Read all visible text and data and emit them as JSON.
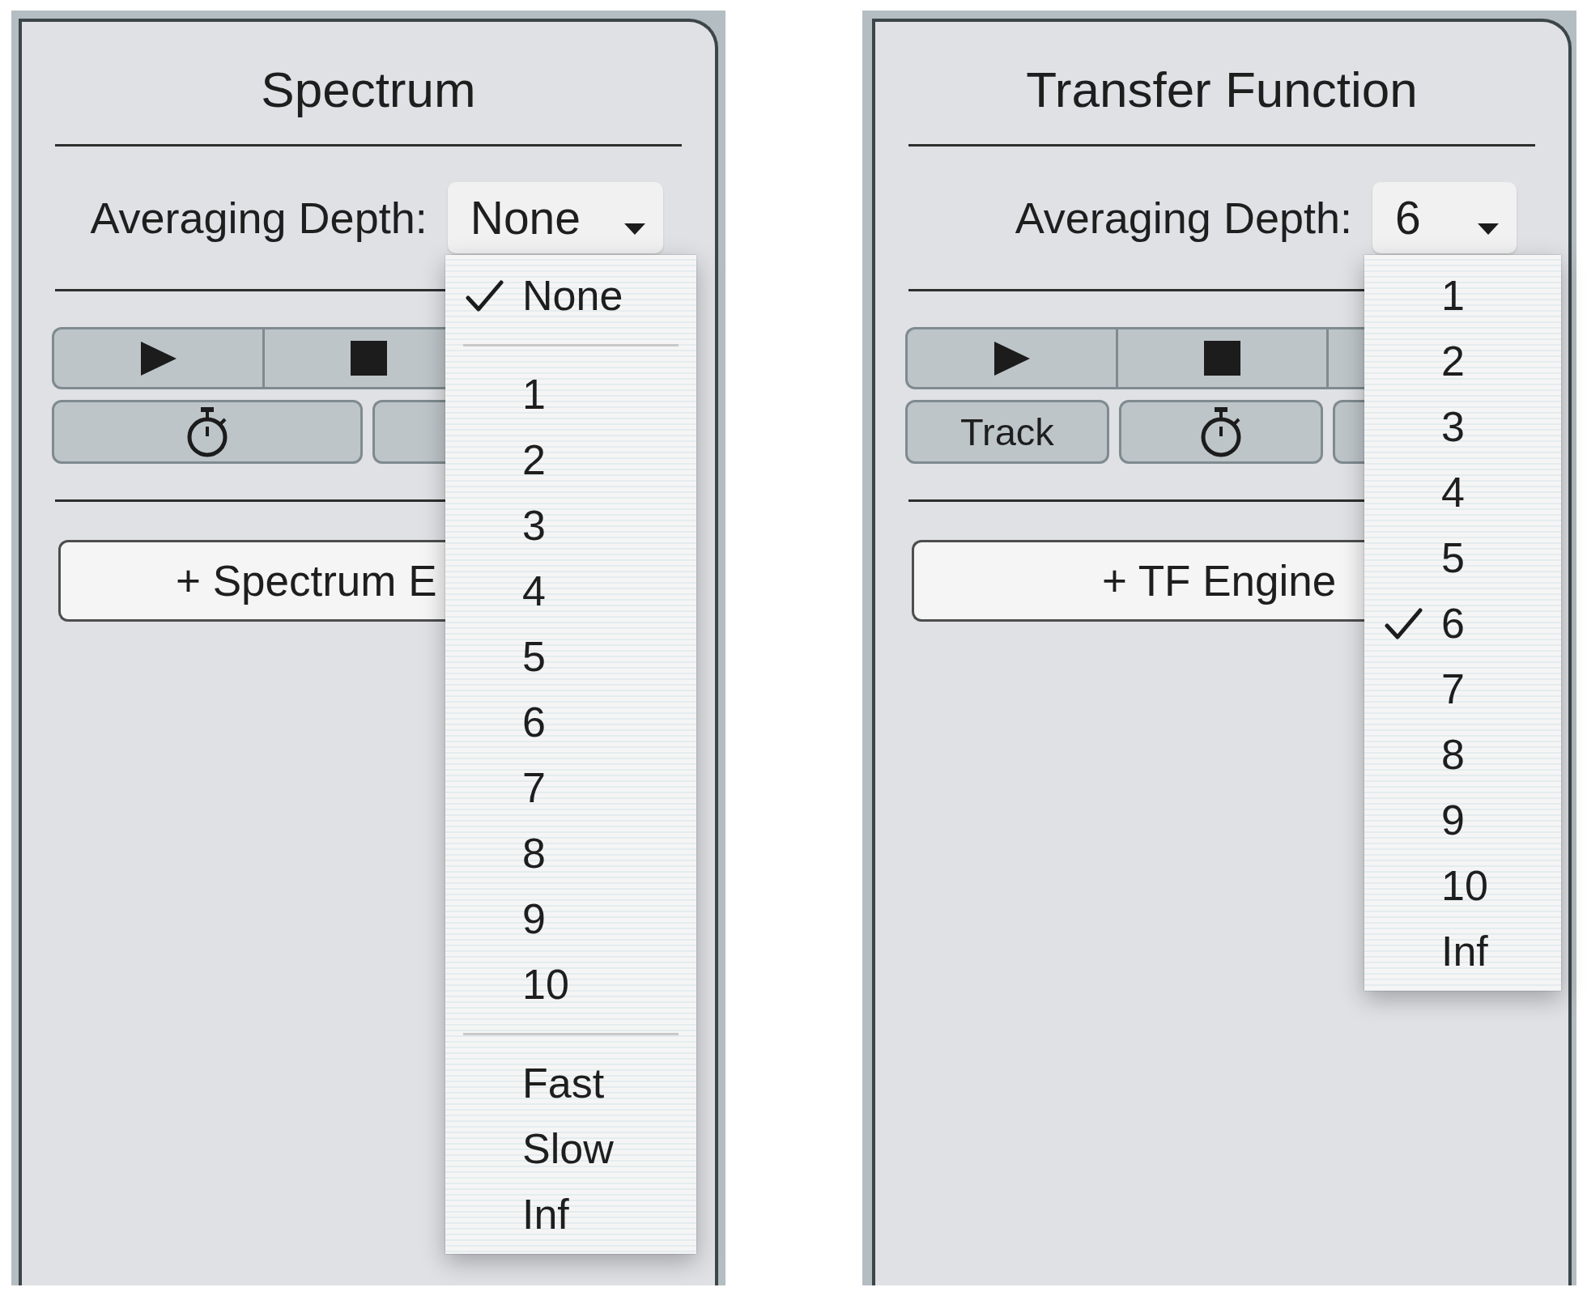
{
  "panels": [
    {
      "title": "Spectrum",
      "averaging_depth": {
        "label": "Averaging Depth:",
        "value": "None"
      },
      "transport_buttons": [
        {
          "kind": "play"
        },
        {
          "kind": "stop"
        }
      ],
      "mode_buttons": [
        {
          "kind": "timer"
        },
        {
          "kind": "blank"
        }
      ],
      "add_button": {
        "label": "+ Spectrum E"
      },
      "menu": [
        {
          "kind": "option",
          "label": "None",
          "selected": true
        },
        {
          "kind": "separator"
        },
        {
          "kind": "option",
          "label": "1",
          "selected": false
        },
        {
          "kind": "option",
          "label": "2",
          "selected": false
        },
        {
          "kind": "option",
          "label": "3",
          "selected": false
        },
        {
          "kind": "option",
          "label": "4",
          "selected": false
        },
        {
          "kind": "option",
          "label": "5",
          "selected": false
        },
        {
          "kind": "option",
          "label": "6",
          "selected": false
        },
        {
          "kind": "option",
          "label": "7",
          "selected": false
        },
        {
          "kind": "option",
          "label": "8",
          "selected": false
        },
        {
          "kind": "option",
          "label": "9",
          "selected": false
        },
        {
          "kind": "option",
          "label": "10",
          "selected": false
        },
        {
          "kind": "separator"
        },
        {
          "kind": "option",
          "label": "Fast",
          "selected": false
        },
        {
          "kind": "option",
          "label": "Slow",
          "selected": false
        },
        {
          "kind": "option",
          "label": "Inf",
          "selected": false
        }
      ]
    },
    {
      "title": "Transfer Function",
      "averaging_depth": {
        "label": "Averaging Depth:",
        "value": "6"
      },
      "transport_buttons": [
        {
          "kind": "play"
        },
        {
          "kind": "stop"
        },
        {
          "kind": "blank"
        }
      ],
      "mode_buttons": [
        {
          "kind": "track",
          "label": "Track"
        },
        {
          "kind": "timer"
        },
        {
          "kind": "blank"
        }
      ],
      "add_button": {
        "label": "+ TF Engine"
      },
      "menu": [
        {
          "kind": "option",
          "label": "1",
          "selected": false
        },
        {
          "kind": "option",
          "label": "2",
          "selected": false
        },
        {
          "kind": "option",
          "label": "3",
          "selected": false
        },
        {
          "kind": "option",
          "label": "4",
          "selected": false
        },
        {
          "kind": "option",
          "label": "5",
          "selected": false
        },
        {
          "kind": "option",
          "label": "6",
          "selected": true
        },
        {
          "kind": "option",
          "label": "7",
          "selected": false
        },
        {
          "kind": "option",
          "label": "8",
          "selected": false
        },
        {
          "kind": "option",
          "label": "9",
          "selected": false
        },
        {
          "kind": "option",
          "label": "10",
          "selected": false
        },
        {
          "kind": "option",
          "label": "Inf",
          "selected": false
        }
      ]
    }
  ]
}
